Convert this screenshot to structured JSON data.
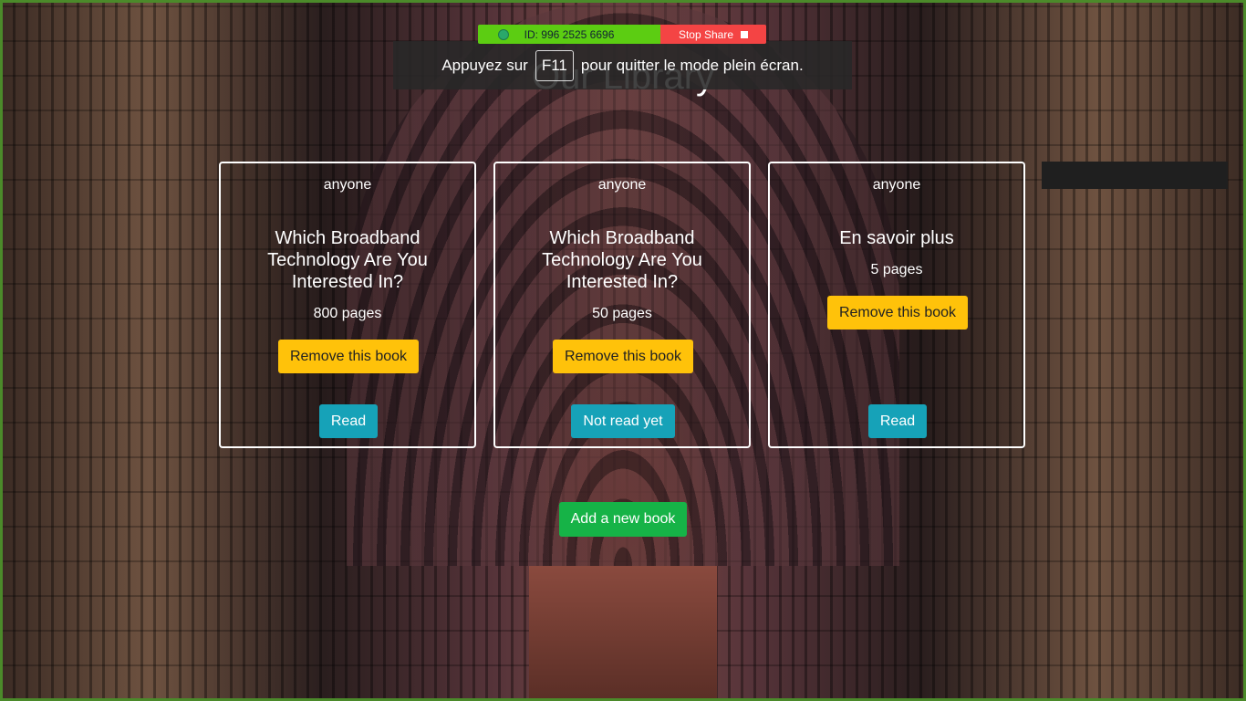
{
  "share_bar": {
    "id_label": "ID: 996 2525 6696",
    "stop_label": "Stop Share",
    "colors": {
      "id_bg": "#5ccd12",
      "stop_bg": "#f44444"
    }
  },
  "fullscreen_toast": {
    "prefix": "Appuyez sur",
    "key": "F11",
    "suffix": "pour quitter le mode plein écran."
  },
  "page": {
    "title": "Our Library"
  },
  "books": [
    {
      "author": "anyone",
      "title": "Which Broadband Technology Are You Interested In?",
      "pages": "800 pages",
      "remove_label": "Remove this book",
      "status_label": "Read"
    },
    {
      "author": "anyone",
      "title": "Which Broadband Technology Are You Interested In?",
      "pages": "50 pages",
      "remove_label": "Remove this book",
      "status_label": "Not read yet"
    },
    {
      "author": "anyone",
      "title": "En savoir plus",
      "pages": "5 pages",
      "remove_label": "Remove this book",
      "status_label": "Read"
    }
  ],
  "actions": {
    "add_label": "Add a new book"
  },
  "colors": {
    "remove_button": "#ffc20a",
    "status_button": "#16a2b8",
    "add_button": "#16b347"
  }
}
